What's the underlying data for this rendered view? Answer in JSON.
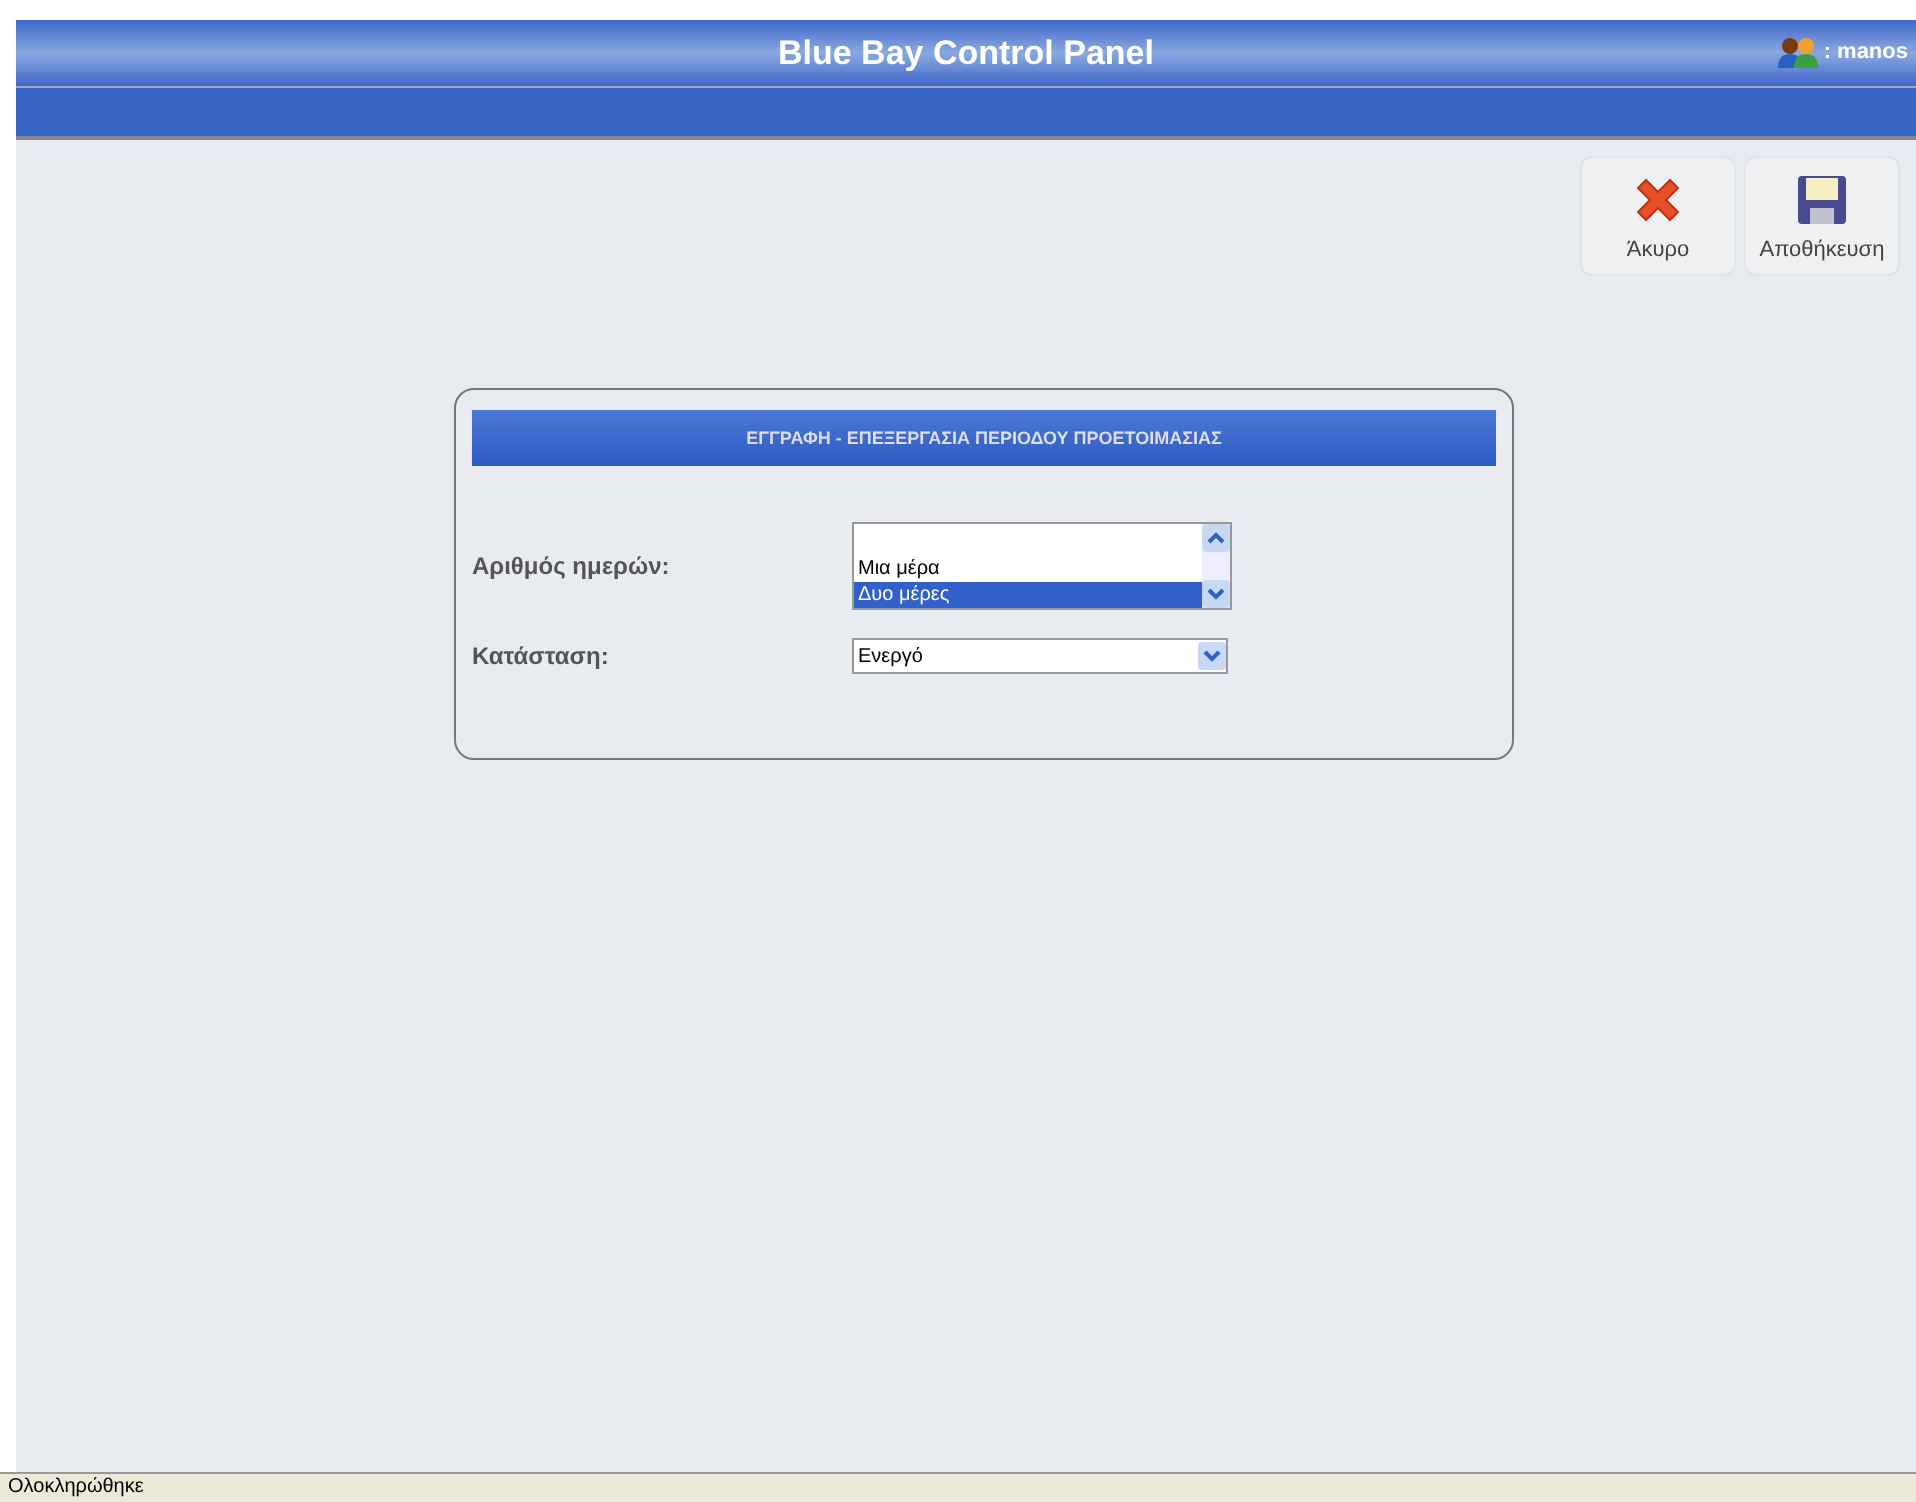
{
  "header": {
    "title": "Blue Bay Control Panel",
    "user": ": manos"
  },
  "toolbar": [
    {
      "kind": "cancel",
      "label": "Άκυρο"
    },
    {
      "kind": "save",
      "label": "Αποθήκευση"
    }
  ],
  "form": {
    "title": "ΕΓΓΡΑΦΗ - ΕΠΕΞΕΡΓΑΣΙΑ ΠΕΡΙΟΔΟΥ ΠΡΟΕΤΟΙΜΑΣΙΑΣ",
    "fields": [
      {
        "kind": "listbox",
        "label": "Αριθμός ημερών:",
        "options": [
          {
            "label": "Μια μέρα",
            "selected": false
          },
          {
            "label": "Δυο μέρες",
            "selected": true
          }
        ]
      },
      {
        "kind": "select",
        "label": "Κατάσταση:",
        "value": "Ενεργό"
      }
    ]
  },
  "status_bar": "Ολοκληρώθηκε"
}
